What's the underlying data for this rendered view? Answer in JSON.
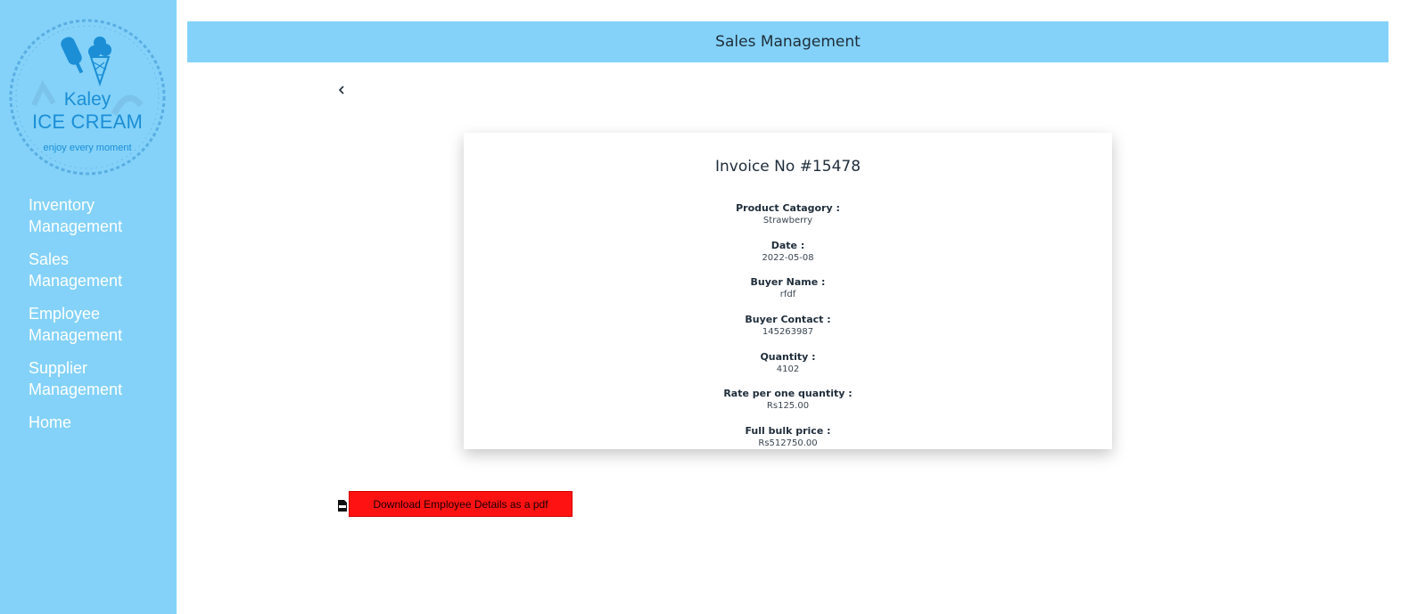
{
  "brand": {
    "name_line1": "Kaley",
    "name_line2": "ICE CREAM",
    "tagline": "enjoy every moment"
  },
  "sidebar": {
    "items": [
      {
        "label_line1": "Inventory",
        "label_line2": "Management"
      },
      {
        "label_line1": "Sales",
        "label_line2": "Management"
      },
      {
        "label_line1": "Employee",
        "label_line2": "Management"
      },
      {
        "label_line1": "Supplier",
        "label_line2": "Management"
      },
      {
        "label_line1": "Home",
        "label_line2": ""
      }
    ]
  },
  "header": {
    "title": "Sales Management"
  },
  "back_icon": "chevron-left-icon",
  "invoice": {
    "title": "Invoice No #15478",
    "fields": [
      {
        "label": "Product Catagory :",
        "value": "Strawberry"
      },
      {
        "label": "Date :",
        "value": "2022-05-08"
      },
      {
        "label": "Buyer Name :",
        "value": "rfdf"
      },
      {
        "label": "Buyer Contact :",
        "value": "145263987"
      },
      {
        "label": "Quantity :",
        "value": "4102"
      },
      {
        "label": "Rate per one quantity :",
        "value": "Rs125.00"
      },
      {
        "label": "Full bulk price :",
        "value": "Rs512750.00"
      }
    ]
  },
  "download": {
    "icon": "pdf-file-icon",
    "label": "Download Employee Details as a pdf"
  },
  "colors": {
    "sidebar_bg": "#84d2f9",
    "header_bg": "#84d2f9",
    "button_bg": "#ff1212",
    "brand_blue": "#1b8ed6"
  }
}
